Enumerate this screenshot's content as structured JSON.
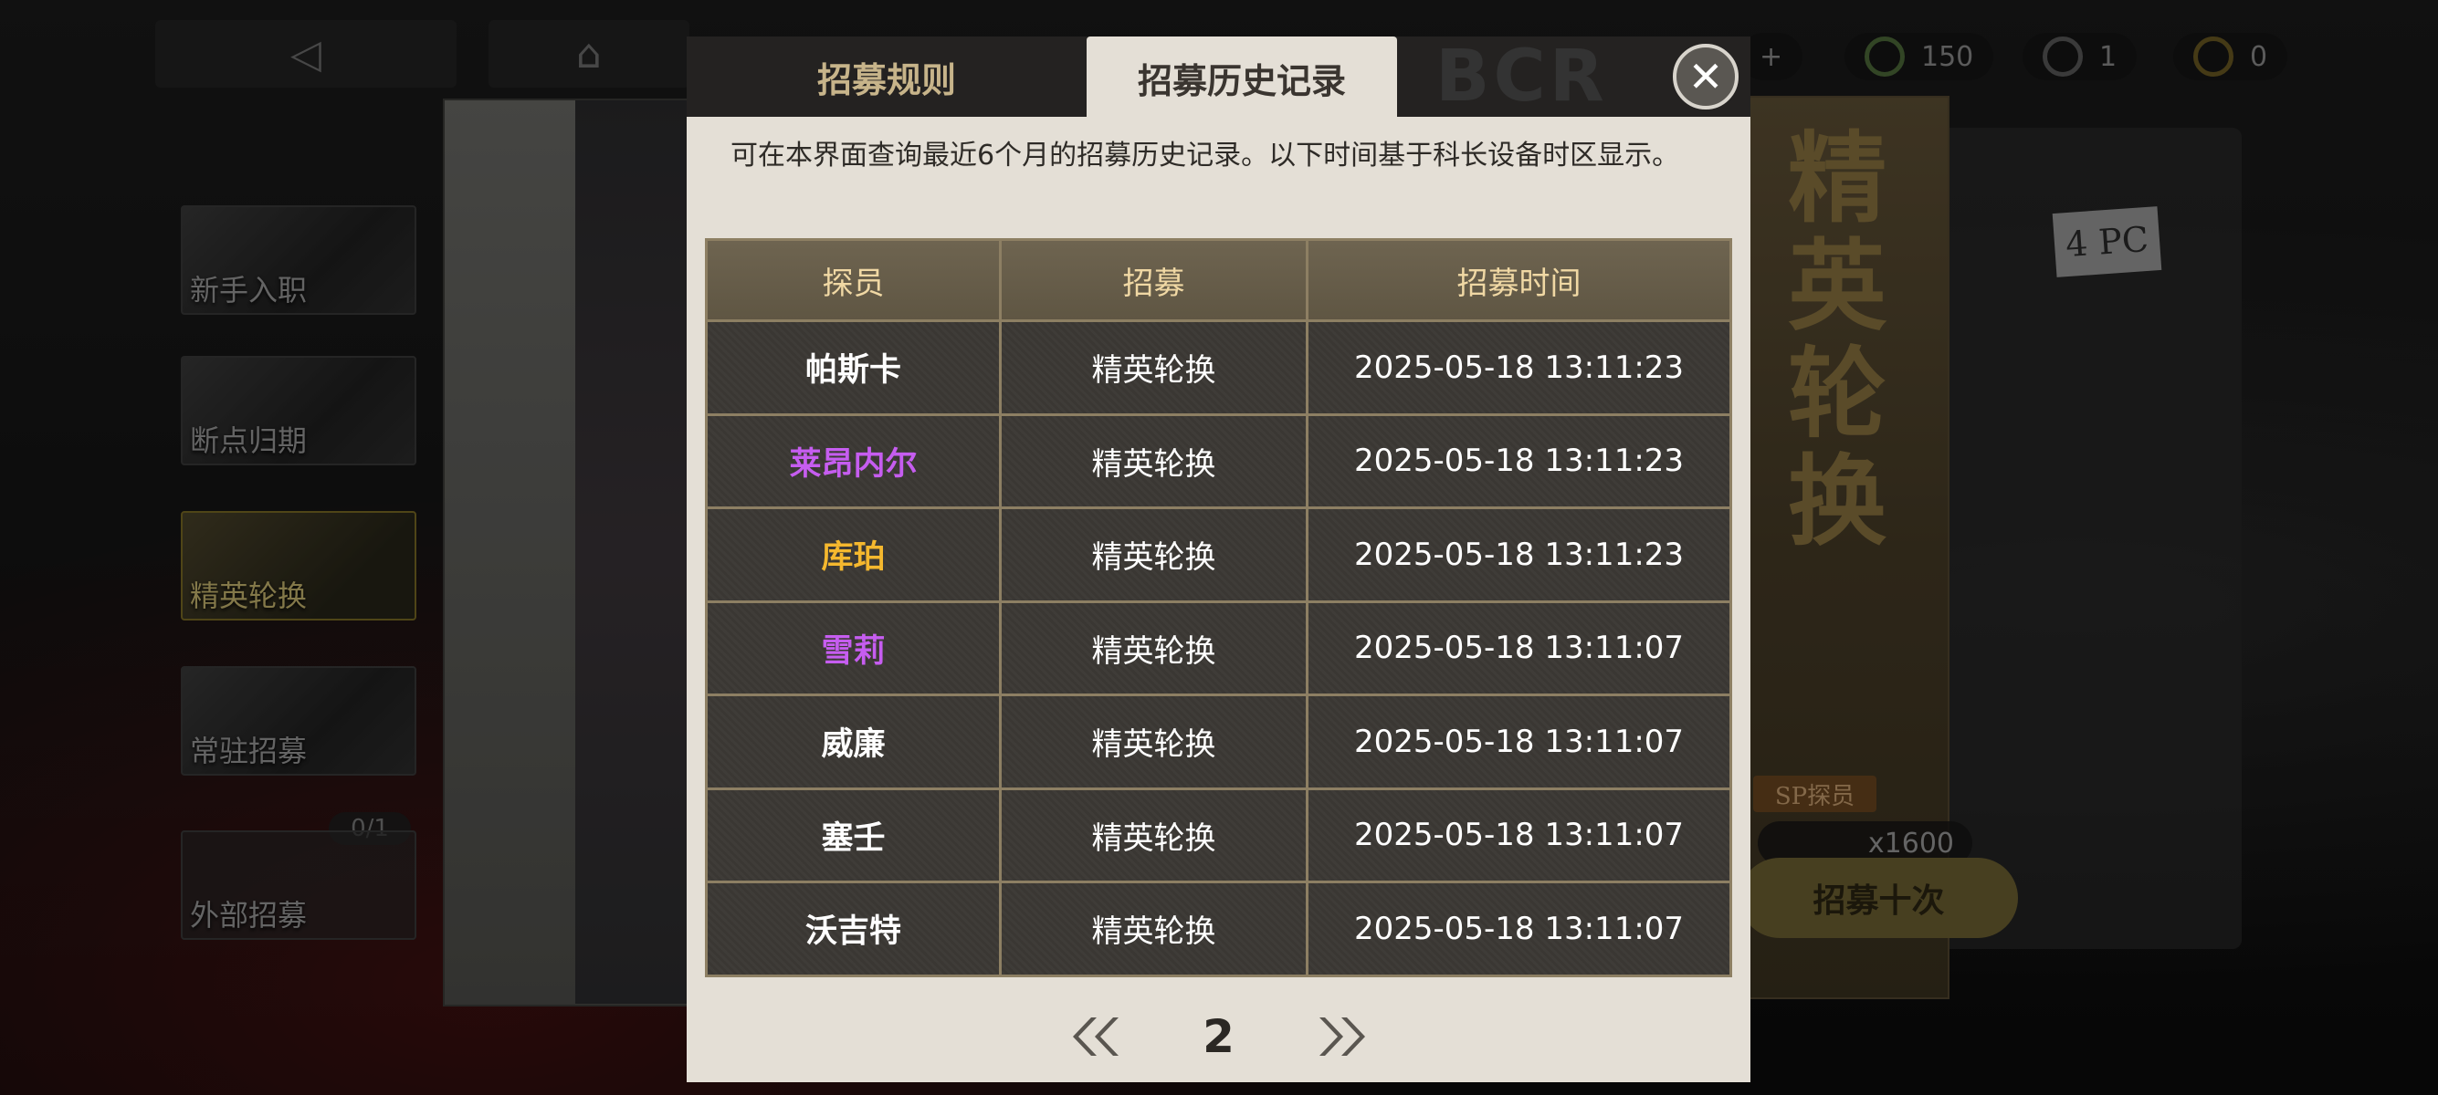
{
  "background": {
    "resources": [
      {
        "icon": "green-orb-icon",
        "value": "150"
      },
      {
        "icon": "gear-token-icon",
        "value": "1"
      },
      {
        "icon": "gold-coin-icon",
        "value": "0"
      }
    ],
    "side_menu": [
      {
        "label": "新手入职"
      },
      {
        "label": "断点归期"
      },
      {
        "label": "精英轮换"
      },
      {
        "label": "常驻招募"
      },
      {
        "label": "外部招募"
      }
    ],
    "locked_count": "0/1",
    "banner_vertical_text": "精英轮换",
    "card_tag": "4 PC",
    "sp_badge": "SP探员",
    "cost": "x1600",
    "recruit_ten": "招募十次"
  },
  "modal": {
    "tabs": {
      "rules": "招募规则",
      "history": "招募历史记录"
    },
    "watermark": "BCR",
    "notice": "可在本界面查询最近6个月的招募历史记录。以下时间基于科长设备时区显示。",
    "table": {
      "headers": [
        "探员",
        "招募",
        "招募时间"
      ],
      "rows": [
        {
          "name": "帕斯卡",
          "pool": "精英轮换",
          "time": "2025-05-18 13:11:23",
          "color": "#ffffff"
        },
        {
          "name": "莱昂内尔",
          "pool": "精英轮换",
          "time": "2025-05-18 13:11:23",
          "color": "#c65df0"
        },
        {
          "name": "库珀",
          "pool": "精英轮换",
          "time": "2025-05-18 13:11:23",
          "color": "#f5b82e"
        },
        {
          "name": "雪莉",
          "pool": "精英轮换",
          "time": "2025-05-18 13:11:07",
          "color": "#c65df0"
        },
        {
          "name": "威廉",
          "pool": "精英轮换",
          "time": "2025-05-18 13:11:07",
          "color": "#ffffff"
        },
        {
          "name": "塞壬",
          "pool": "精英轮换",
          "time": "2025-05-18 13:11:07",
          "color": "#ffffff"
        },
        {
          "name": "沃吉特",
          "pool": "精英轮换",
          "time": "2025-05-18 13:11:07",
          "color": "#ffffff"
        }
      ]
    },
    "pager": {
      "current_page": "2"
    }
  }
}
